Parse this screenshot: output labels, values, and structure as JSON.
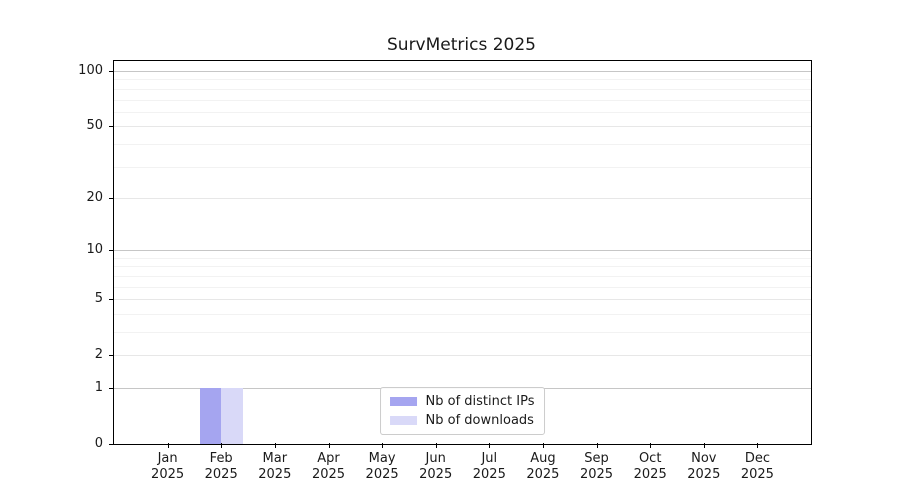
{
  "figure": {
    "background": "#ffffff"
  },
  "chart_data": {
    "type": "bar",
    "title": "SurvMetrics 2025",
    "xlabel": "",
    "ylabel": "",
    "yscale": "log1p",
    "ylim": [
      0,
      113.3
    ],
    "categories": [
      "Jan 2025",
      "Feb 2025",
      "Mar 2025",
      "Apr 2025",
      "May 2025",
      "Jun 2025",
      "Jul 2025",
      "Aug 2025",
      "Sep 2025",
      "Oct 2025",
      "Nov 2025",
      "Dec 2025"
    ],
    "x_ticks": [
      {
        "month": "Jan",
        "year": "2025"
      },
      {
        "month": "Feb",
        "year": "2025"
      },
      {
        "month": "Mar",
        "year": "2025"
      },
      {
        "month": "Apr",
        "year": "2025"
      },
      {
        "month": "May",
        "year": "2025"
      },
      {
        "month": "Jun",
        "year": "2025"
      },
      {
        "month": "Jul",
        "year": "2025"
      },
      {
        "month": "Aug",
        "year": "2025"
      },
      {
        "month": "Sep",
        "year": "2025"
      },
      {
        "month": "Oct",
        "year": "2025"
      },
      {
        "month": "Nov",
        "year": "2025"
      },
      {
        "month": "Dec",
        "year": "2025"
      }
    ],
    "series": [
      {
        "name": "Nb of distinct IPs",
        "color": "#a5a5f0",
        "values": [
          0,
          1,
          0,
          0,
          0,
          0,
          0,
          0,
          0,
          0,
          0,
          0
        ]
      },
      {
        "name": "Nb of downloads",
        "color": "#d9d9f8",
        "values": [
          0,
          1,
          0,
          0,
          0,
          0,
          0,
          0,
          0,
          0,
          0,
          0
        ]
      }
    ],
    "y_ticks": [
      {
        "value": 0,
        "label": "0"
      },
      {
        "value": 1,
        "label": "1"
      },
      {
        "value": 2,
        "label": "2"
      },
      {
        "value": 5,
        "label": "5"
      },
      {
        "value": 10,
        "label": "10"
      },
      {
        "value": 20,
        "label": "20"
      },
      {
        "value": 50,
        "label": "50"
      },
      {
        "value": 100,
        "label": "100"
      }
    ],
    "gridlines": [
      {
        "level": "decade",
        "color": "#c6c6c6",
        "values": [
          1,
          10,
          100
        ]
      },
      {
        "level": "labeled",
        "color": "#e7e7e7",
        "values": [
          2,
          5,
          20,
          50
        ]
      },
      {
        "level": "minor",
        "color": "#f2f2f2",
        "values": [
          3,
          4,
          6,
          7,
          8,
          9,
          30,
          40,
          60,
          70,
          80,
          90
        ]
      }
    ],
    "bar_width_frac": 0.4,
    "grid": true,
    "legend_position": "lower center",
    "axis_color": "#000000",
    "text_color": "#1a1a1a"
  }
}
